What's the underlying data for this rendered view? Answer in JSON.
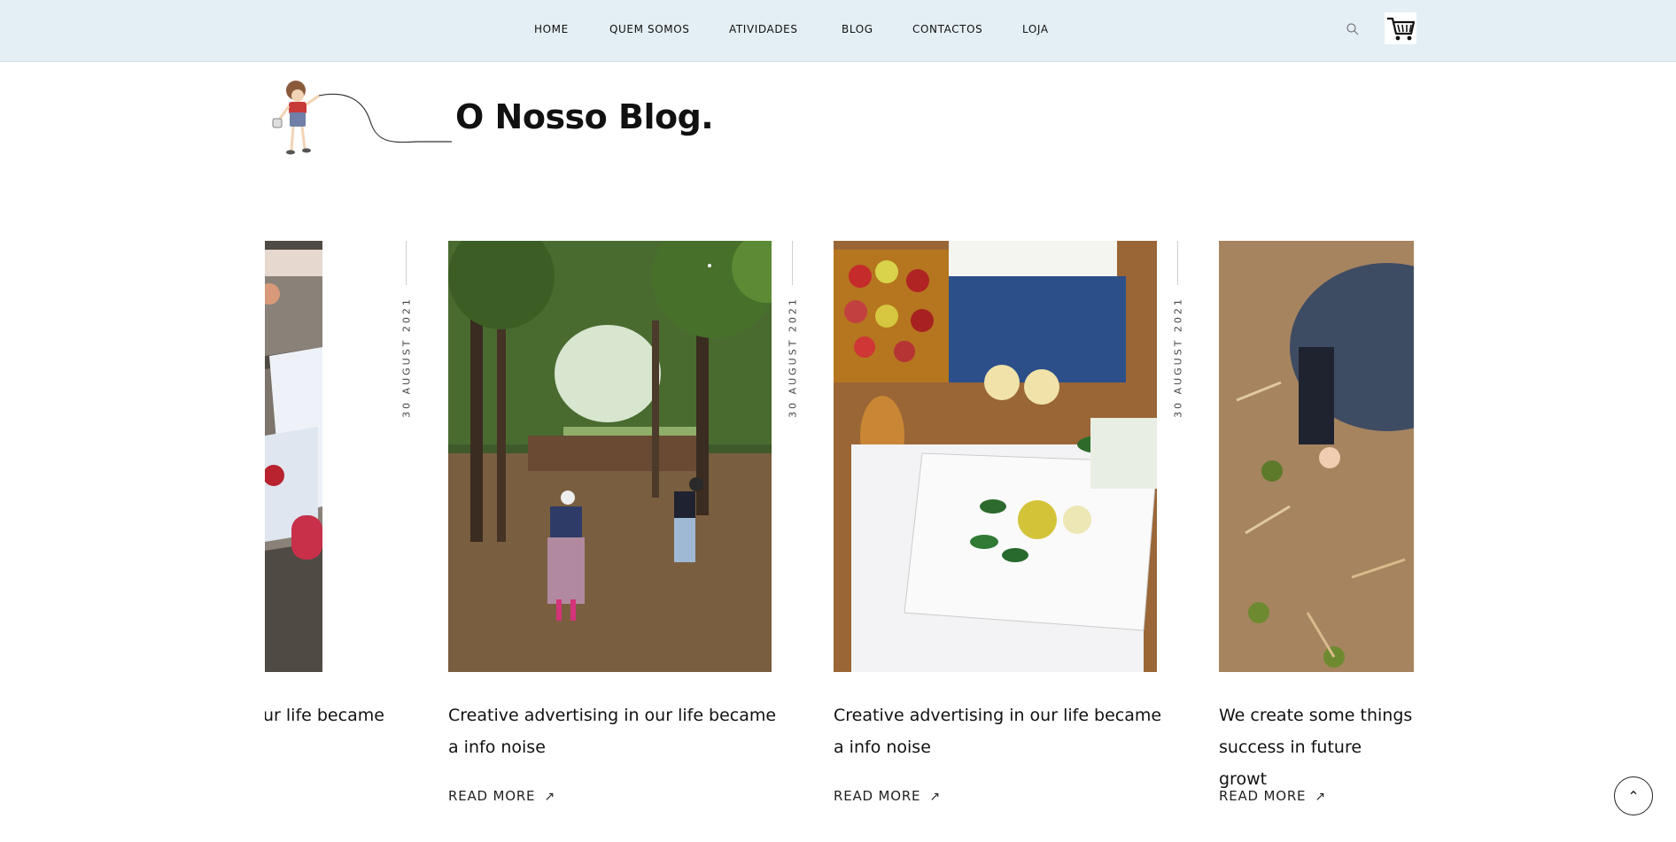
{
  "nav": {
    "items": [
      "HOME",
      "QUEM SOMOS",
      "ATIVIDADES",
      "BLOG",
      "CONTACTOS",
      "LOJA"
    ]
  },
  "header": {
    "search_icon": "search-icon",
    "cart_icon": "cart-icon"
  },
  "page": {
    "title": "O Nosso Blog."
  },
  "cards": [
    {
      "date": "30 AUGUST 2021",
      "title": "Creative advertising in our life became a info noise",
      "read_more": "READ MORE",
      "arrow": "↗"
    },
    {
      "date": "30 AUGUST 2021",
      "title": "Creative advertising in our life became a info noise",
      "read_more": "READ MORE",
      "arrow": "↗"
    },
    {
      "date": "30 AUGUST 2021",
      "title": "Creative advertising in our life became a info noise",
      "read_more": "READ MORE",
      "arrow": "↗"
    },
    {
      "date": "",
      "title": "We create some things success in future growt",
      "read_more": "READ MORE",
      "arrow": "↗"
    }
  ],
  "partial_card": {
    "title": "ur life became"
  },
  "back_to_top": {
    "icon": "chevron-up-icon",
    "glyph": "⌃"
  },
  "colors": {
    "header_bg": "#e3eff5",
    "text": "#111111"
  }
}
